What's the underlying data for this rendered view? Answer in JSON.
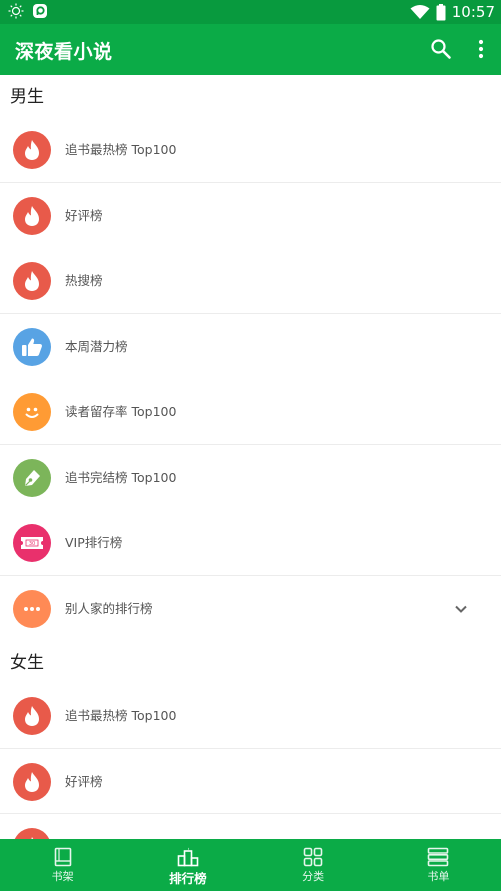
{
  "status_bar": {
    "time": "10:57",
    "icons": [
      "brightness-icon",
      "notification-app-icon",
      "wifi-icon",
      "battery-icon"
    ]
  },
  "app_bar": {
    "title": "深夜看小说",
    "actions": [
      "search-icon",
      "more-vert-icon"
    ]
  },
  "sections": [
    {
      "title": "男生",
      "items": [
        {
          "label": "追书最热榜 Top100",
          "icon": "flame-icon",
          "color": "#e85a4a"
        },
        {
          "label": "好评榜",
          "icon": "flame-icon",
          "color": "#e85a4a"
        },
        {
          "label": "热搜榜",
          "icon": "flame-icon",
          "color": "#e85a4a"
        },
        {
          "label": "本周潜力榜",
          "icon": "thumbs-up-icon",
          "color": "#58a3e4"
        },
        {
          "label": "读者留存率 Top100",
          "icon": "smiley-icon",
          "color": "#ff9b34"
        },
        {
          "label": "追书完结榜 Top100",
          "icon": "pen-icon",
          "color": "#7cb55a"
        },
        {
          "label": "VIP排行榜",
          "icon": "ticket-icon",
          "color": "#e9306c"
        },
        {
          "label": "别人家的排行榜",
          "icon": "ellipsis-icon",
          "color": "#ff8a55",
          "expandable": true
        }
      ]
    },
    {
      "title": "女生",
      "items": [
        {
          "label": "追书最热榜 Top100",
          "icon": "flame-icon",
          "color": "#e85a4a"
        },
        {
          "label": "好评榜",
          "icon": "flame-icon",
          "color": "#e85a4a"
        },
        {
          "label": "",
          "icon": "flame-icon",
          "color": "#e85a4a"
        }
      ]
    }
  ],
  "bottom_nav": {
    "items": [
      {
        "label": "书架",
        "icon": "bookshelf-icon",
        "active": false
      },
      {
        "label": "排行榜",
        "icon": "ranking-icon",
        "active": true
      },
      {
        "label": "分类",
        "icon": "category-icon",
        "active": false
      },
      {
        "label": "书单",
        "icon": "booklist-icon",
        "active": false
      }
    ]
  },
  "colors": {
    "primary": "#0bab47",
    "status_bar": "#089a3e"
  }
}
